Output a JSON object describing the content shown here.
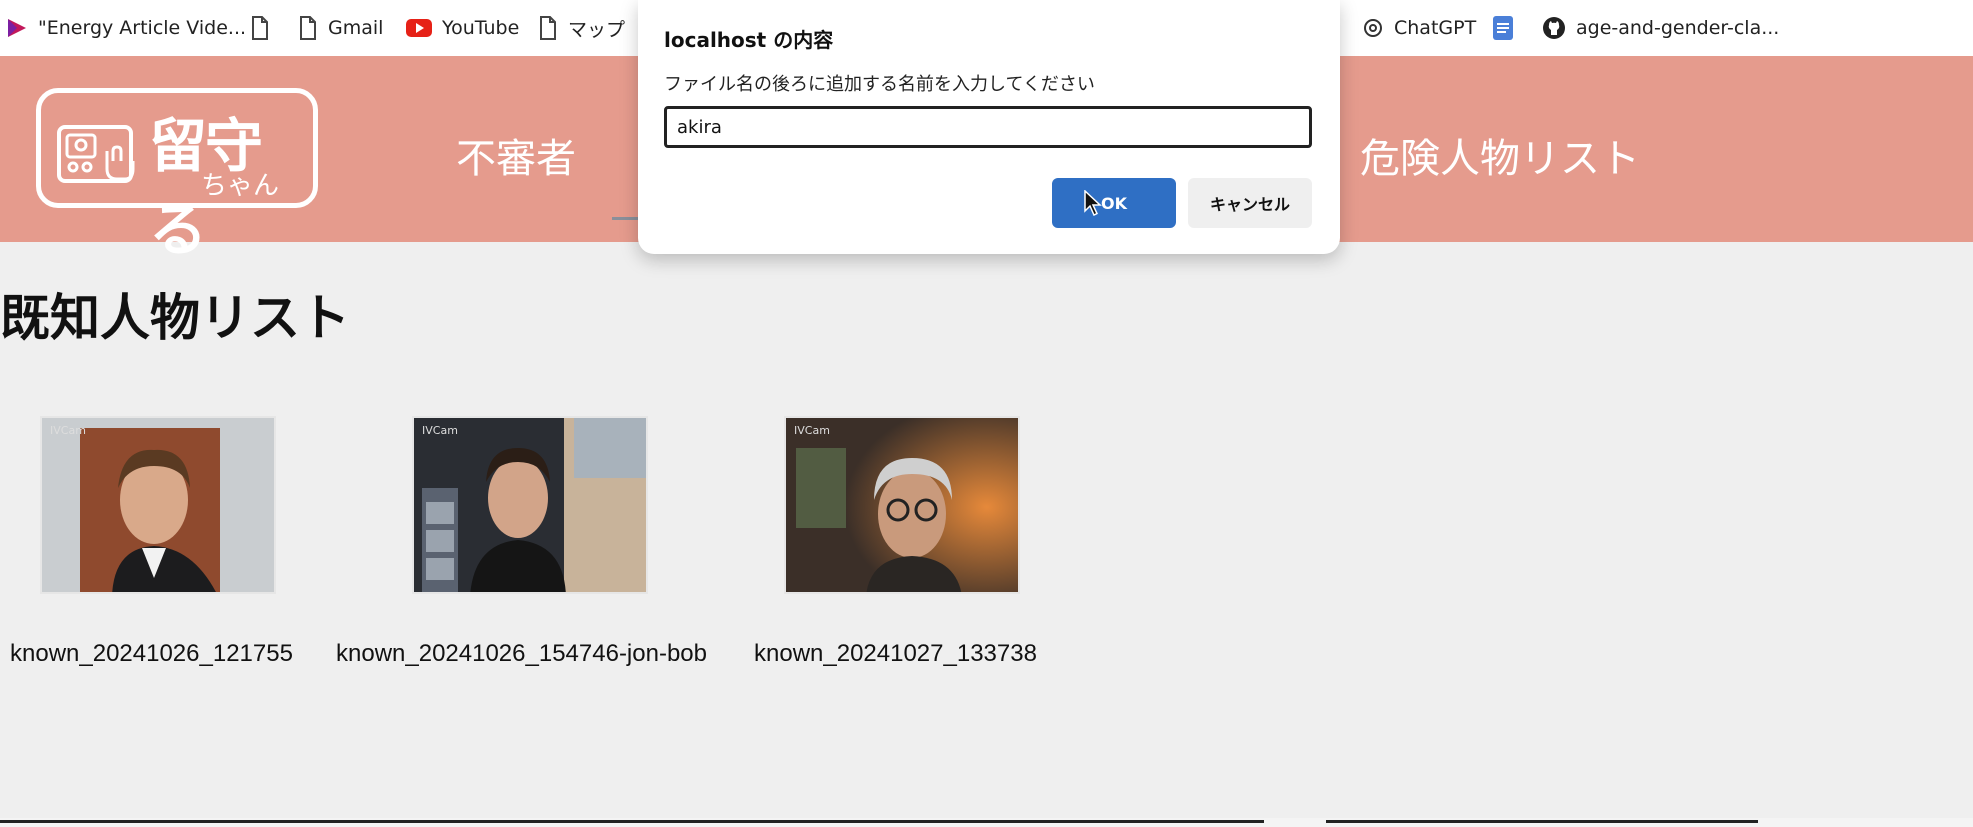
{
  "bookmarks": [
    {
      "label": "\"Energy Article Vide...",
      "icon": "play-icon"
    },
    {
      "label": "",
      "icon": "page-icon"
    },
    {
      "label": "Gmail",
      "icon": "page-icon"
    },
    {
      "label": "YouTube",
      "icon": "youtube-icon"
    },
    {
      "label": "マップ",
      "icon": "page-icon"
    },
    {
      "label": "ChatGPT",
      "icon": "chatgpt-icon"
    },
    {
      "label": "",
      "icon": "docs-icon"
    },
    {
      "label": "age-and-gender-cla...",
      "icon": "github-icon"
    }
  ],
  "header": {
    "logo_text": "留守る",
    "logo_sub": "ちゃん",
    "nav": {
      "suspicious": "不審者",
      "danger_list": "危険人物リスト"
    },
    "colors": {
      "background": "#e59b8d"
    }
  },
  "main": {
    "title": "既知人物リスト",
    "people": [
      {
        "label": "known_20241026_121755",
        "cam": "IVCam"
      },
      {
        "label": "known_20241026_154746-jon-bob",
        "cam": "IVCam"
      },
      {
        "label": "known_20241027_133738",
        "cam": "IVCam"
      }
    ]
  },
  "dialog": {
    "title": "localhost の内容",
    "message": "ファイル名の後ろに追加する名前を入力してください",
    "input_value": "akira",
    "ok_label": "OK",
    "cancel_label": "キャンセル",
    "colors": {
      "ok": "#2f6fc4"
    }
  }
}
